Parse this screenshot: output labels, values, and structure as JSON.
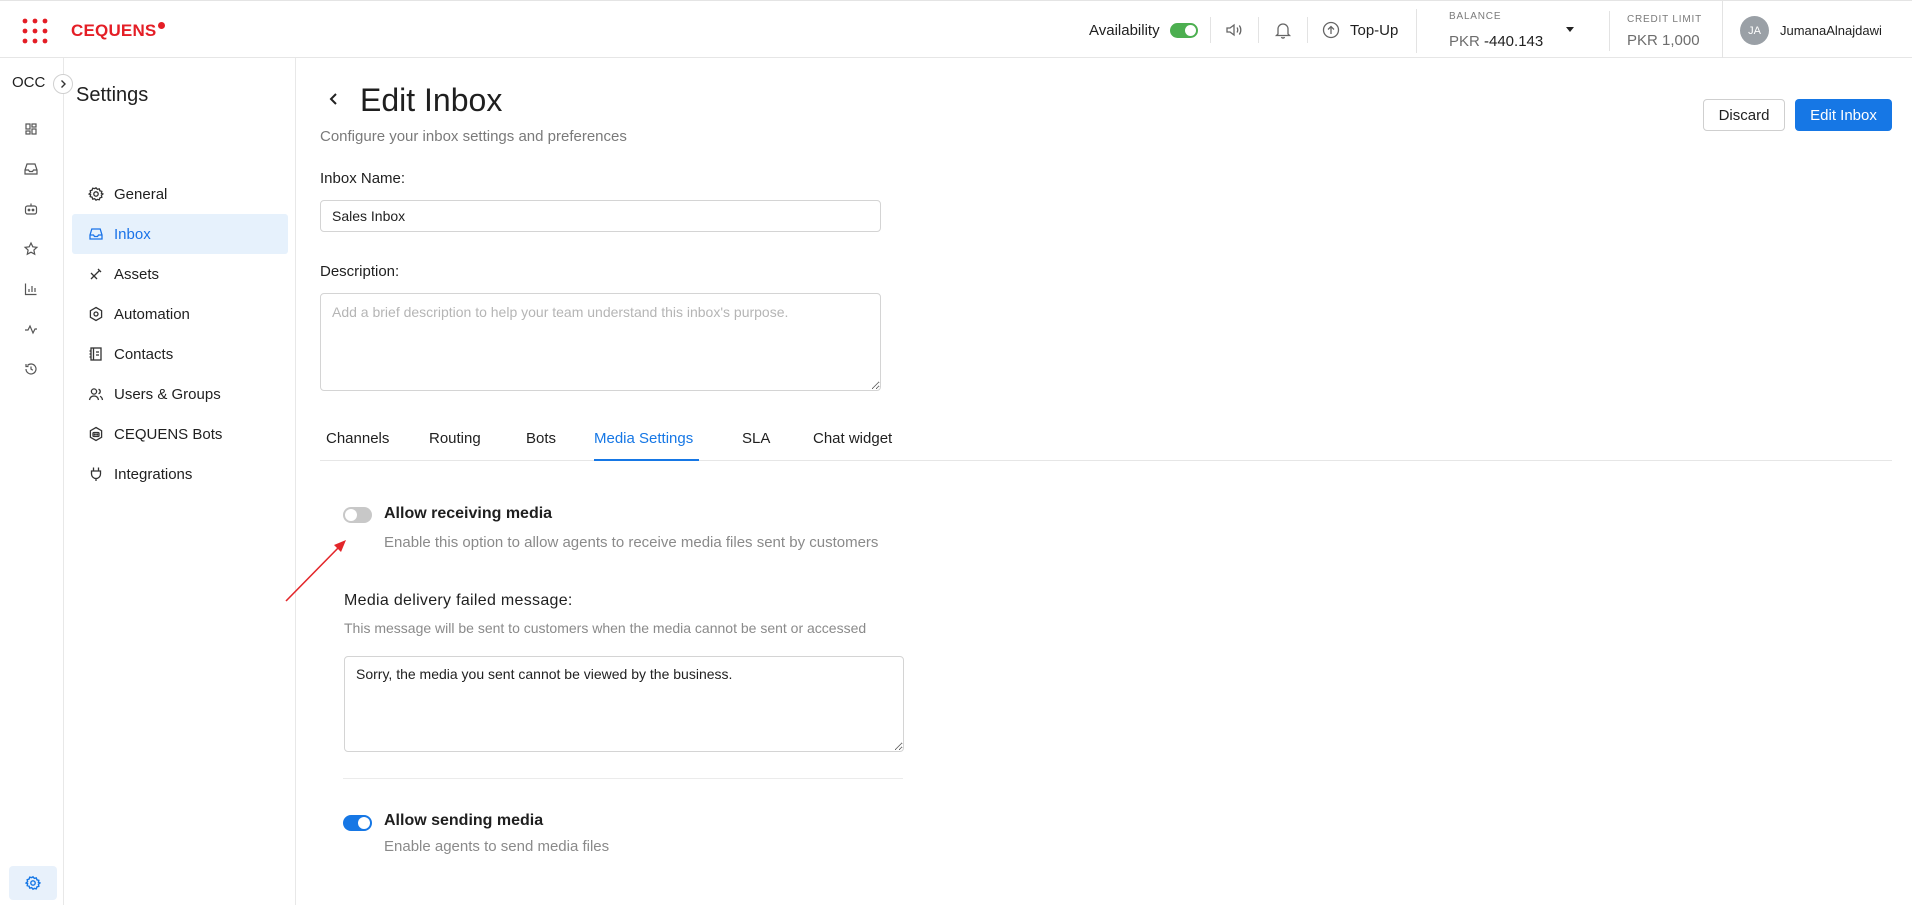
{
  "topbar": {
    "logo": "CEQUENS",
    "availability_label": "Availability",
    "topup_label": "Top-Up",
    "balance_caption": "BALANCE",
    "balance_currency": "PKR",
    "balance_value": "-440.143",
    "credit_caption": "CREDIT LIMIT",
    "credit_value": "PKR 1,000",
    "avatar_initials": "JA",
    "username": "JumanaAlnajdawi",
    "availability_on": true
  },
  "rail": {
    "title": "OCC"
  },
  "settings_nav": {
    "title": "Settings",
    "items": [
      {
        "label": "General",
        "icon": "gear-icon"
      },
      {
        "label": "Inbox",
        "icon": "inbox-icon",
        "active": true
      },
      {
        "label": "Assets",
        "icon": "tools-icon"
      },
      {
        "label": "Automation",
        "icon": "automation-hexagon-icon"
      },
      {
        "label": "Contacts",
        "icon": "contacts-book-icon"
      },
      {
        "label": "Users & Groups",
        "icon": "users-icon"
      },
      {
        "label": "CEQUENS Bots",
        "icon": "bot-icon"
      },
      {
        "label": "Integrations",
        "icon": "plug-icon"
      }
    ]
  },
  "page": {
    "title": "Edit Inbox",
    "subtitle": "Configure your inbox settings and preferences",
    "discard_label": "Discard",
    "save_label": "Edit Inbox"
  },
  "form": {
    "inbox_name_label": "Inbox Name:",
    "inbox_name_value": "Sales Inbox",
    "description_label": "Description:",
    "description_placeholder": "Add a brief description to help your team understand this inbox's purpose."
  },
  "tabs": [
    {
      "label": "Channels"
    },
    {
      "label": "Routing"
    },
    {
      "label": "Bots"
    },
    {
      "label": "Media Settings",
      "active": true
    },
    {
      "label": "SLA"
    },
    {
      "label": "Chat widget"
    }
  ],
  "media": {
    "receive_title": "Allow receiving media",
    "receive_desc": "Enable this option to allow agents to receive media files sent by customers",
    "receive_enabled": false,
    "failed_label": "Media delivery failed message:",
    "failed_desc": "This message will be sent to customers when the media cannot be sent or accessed",
    "failed_message": "Sorry, the media you sent cannot be viewed by the business.",
    "send_title": "Allow sending media",
    "send_desc": "Enable agents to send media files",
    "send_enabled": true
  },
  "colors": {
    "brand_red": "#e41e26",
    "primary_blue": "#1677e5",
    "availability_green": "#4caf50"
  }
}
